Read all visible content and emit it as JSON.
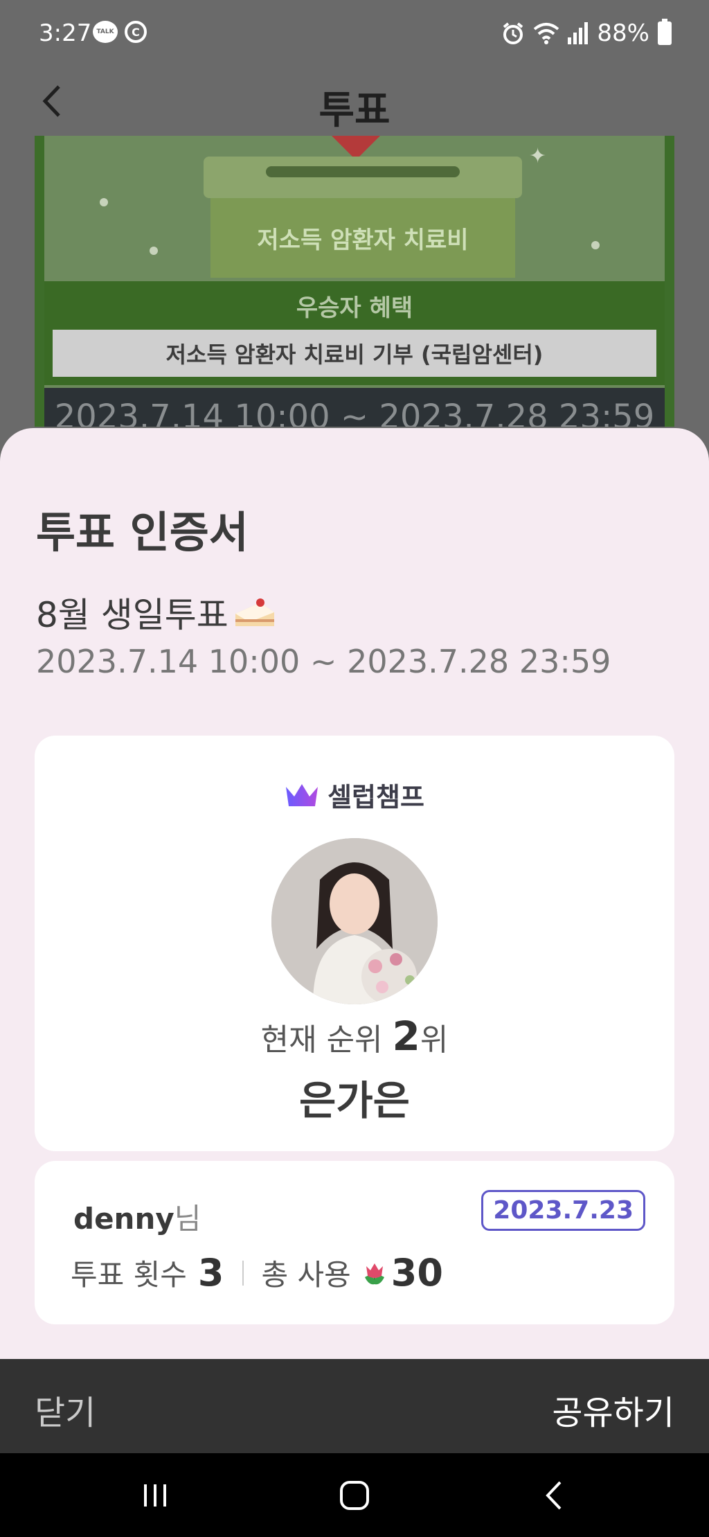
{
  "status_bar": {
    "time": "3:27",
    "talk_icon_text": "TALK",
    "battery": "88%"
  },
  "header": {
    "title": "투표"
  },
  "banner": {
    "box_label": "저소득 암환자 치료비",
    "benefit_title": "우승자 혜택",
    "benefit_text": "저소득 암환자 치료비 기부 (국립암센터)",
    "date_range": "2023.7.14 10:00 ~ 2023.7.28 23:59"
  },
  "certificate": {
    "title": "투표 인증서",
    "vote_name": "8월 생일투표",
    "vote_period": "2023.7.14 10:00 ~ 2023.7.28 23:59",
    "brand": "셀럽챔프",
    "rank_prefix": "현재 순위",
    "rank_number": "2",
    "rank_suffix": "위",
    "celeb_name": "은가은",
    "user_name": "denny",
    "user_suffix": "님",
    "vote_date": "2023.7.23",
    "vote_count_label": "투표 횟수",
    "vote_count": "3",
    "total_used_label": "총 사용",
    "total_used": "30"
  },
  "actions": {
    "close_label": "닫기",
    "share_label": "공유하기"
  },
  "colors": {
    "accent": "#5e57c8",
    "sheet_bg": "#f6ebf2",
    "action_bar": "#323232"
  }
}
